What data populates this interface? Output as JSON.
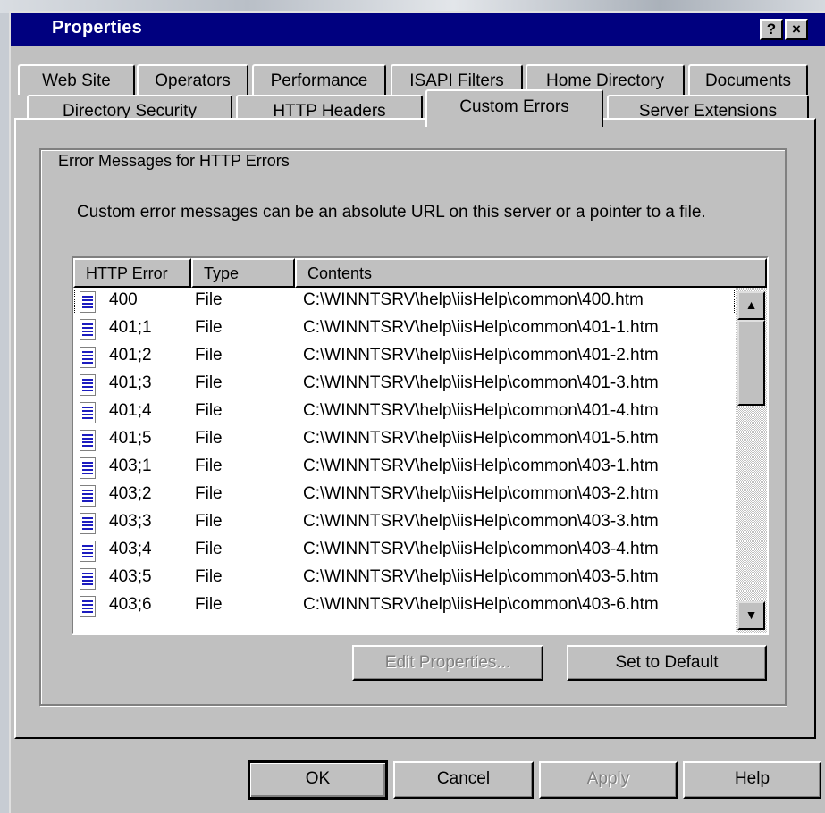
{
  "window": {
    "title": "Properties",
    "help_glyph": "?",
    "close_glyph": "×"
  },
  "tabs": {
    "row_back": [
      "Web Site",
      "Operators",
      "Performance",
      "ISAPI Filters",
      "Home Directory",
      "Documents"
    ],
    "row_front": [
      "Directory Security",
      "HTTP Headers",
      "Custom Errors",
      "Server Extensions"
    ],
    "selected": "Custom Errors"
  },
  "custom_errors": {
    "group_title": "Error Messages for HTTP Errors",
    "description": "Custom error messages can be an absolute URL on this server or a pointer to a file.",
    "columns": [
      "HTTP Error",
      "Type",
      "Contents"
    ],
    "rows": [
      {
        "code": "400",
        "type": "File",
        "contents": "C:\\WINNTSRV\\help\\iisHelp\\common\\400.htm"
      },
      {
        "code": "401;1",
        "type": "File",
        "contents": "C:\\WINNTSRV\\help\\iisHelp\\common\\401-1.htm"
      },
      {
        "code": "401;2",
        "type": "File",
        "contents": "C:\\WINNTSRV\\help\\iisHelp\\common\\401-2.htm"
      },
      {
        "code": "401;3",
        "type": "File",
        "contents": "C:\\WINNTSRV\\help\\iisHelp\\common\\401-3.htm"
      },
      {
        "code": "401;4",
        "type": "File",
        "contents": "C:\\WINNTSRV\\help\\iisHelp\\common\\401-4.htm"
      },
      {
        "code": "401;5",
        "type": "File",
        "contents": "C:\\WINNTSRV\\help\\iisHelp\\common\\401-5.htm"
      },
      {
        "code": "403;1",
        "type": "File",
        "contents": "C:\\WINNTSRV\\help\\iisHelp\\common\\403-1.htm"
      },
      {
        "code": "403;2",
        "type": "File",
        "contents": "C:\\WINNTSRV\\help\\iisHelp\\common\\403-2.htm"
      },
      {
        "code": "403;3",
        "type": "File",
        "contents": "C:\\WINNTSRV\\help\\iisHelp\\common\\403-3.htm"
      },
      {
        "code": "403;4",
        "type": "File",
        "contents": "C:\\WINNTSRV\\help\\iisHelp\\common\\403-4.htm"
      },
      {
        "code": "403;5",
        "type": "File",
        "contents": "C:\\WINNTSRV\\help\\iisHelp\\common\\403-5.htm"
      },
      {
        "code": "403;6",
        "type": "File",
        "contents": "C:\\WINNTSRV\\help\\iisHelp\\common\\403-6.htm"
      }
    ],
    "edit_button": "Edit Properties...",
    "default_button": "Set to Default"
  },
  "footer": {
    "ok": "OK",
    "cancel": "Cancel",
    "apply": "Apply",
    "help": "Help"
  },
  "scroll": {
    "up_glyph": "▲",
    "down_glyph": "▼"
  },
  "icons": {
    "row_icon": "document-icon"
  }
}
